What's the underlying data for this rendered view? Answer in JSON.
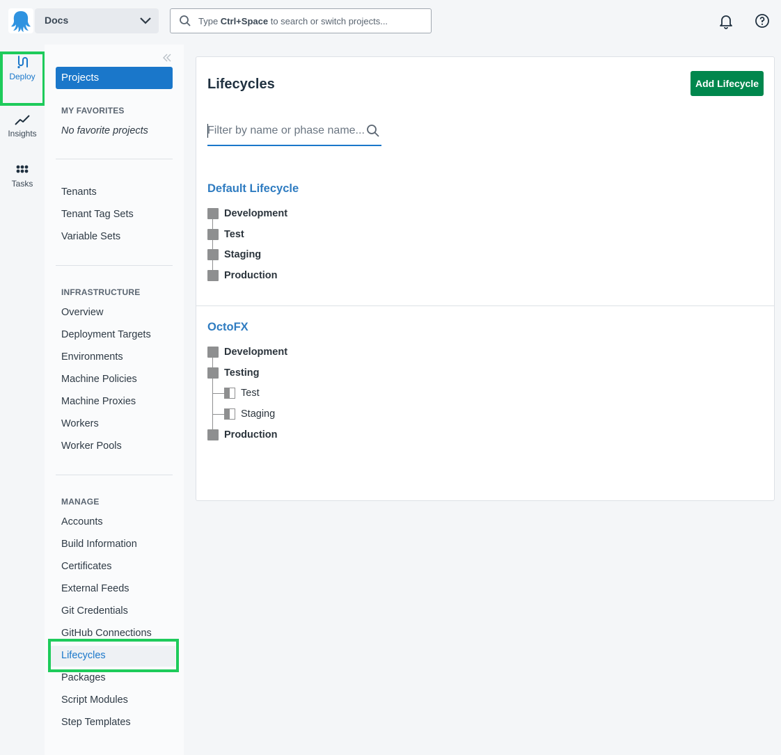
{
  "topbar": {
    "space_name": "Docs",
    "search_placeholder_prefix": "Type ",
    "search_placeholder_shortcut": "Ctrl+Space",
    "search_placeholder_suffix": " to search or switch projects..."
  },
  "rail": {
    "deploy": "Deploy",
    "insights": "Insights",
    "tasks": "Tasks"
  },
  "sidebar": {
    "projects": "Projects",
    "favorites_title": "MY FAVORITES",
    "no_favorites": "No favorite projects",
    "tenant_items": [
      "Tenants",
      "Tenant Tag Sets",
      "Variable Sets"
    ],
    "infrastructure_title": "INFRASTRUCTURE",
    "infrastructure_items": [
      "Overview",
      "Deployment Targets",
      "Environments",
      "Machine Policies",
      "Machine Proxies",
      "Workers",
      "Worker Pools"
    ],
    "manage_title": "MANAGE",
    "manage_items": [
      "Accounts",
      "Build Information",
      "Certificates",
      "External Feeds",
      "Git Credentials",
      "GitHub Connections",
      "Lifecycles",
      "Packages",
      "Script Modules",
      "Step Templates"
    ]
  },
  "main": {
    "title": "Lifecycles",
    "add_button": "Add Lifecycle",
    "filter_placeholder": "Filter by name or phase name...",
    "lifecycles": [
      {
        "name": "Default Lifecycle",
        "phases": [
          {
            "name": "Development"
          },
          {
            "name": "Test"
          },
          {
            "name": "Staging"
          },
          {
            "name": "Production"
          }
        ]
      },
      {
        "name": "OctoFX",
        "phases": [
          {
            "name": "Development"
          },
          {
            "name": "Testing",
            "environments": [
              "Test",
              "Staging"
            ]
          },
          {
            "name": "Production"
          }
        ]
      }
    ]
  },
  "colors": {
    "primary": "#1a77ca",
    "success": "#00874d",
    "highlight": "#1ecb5b"
  }
}
